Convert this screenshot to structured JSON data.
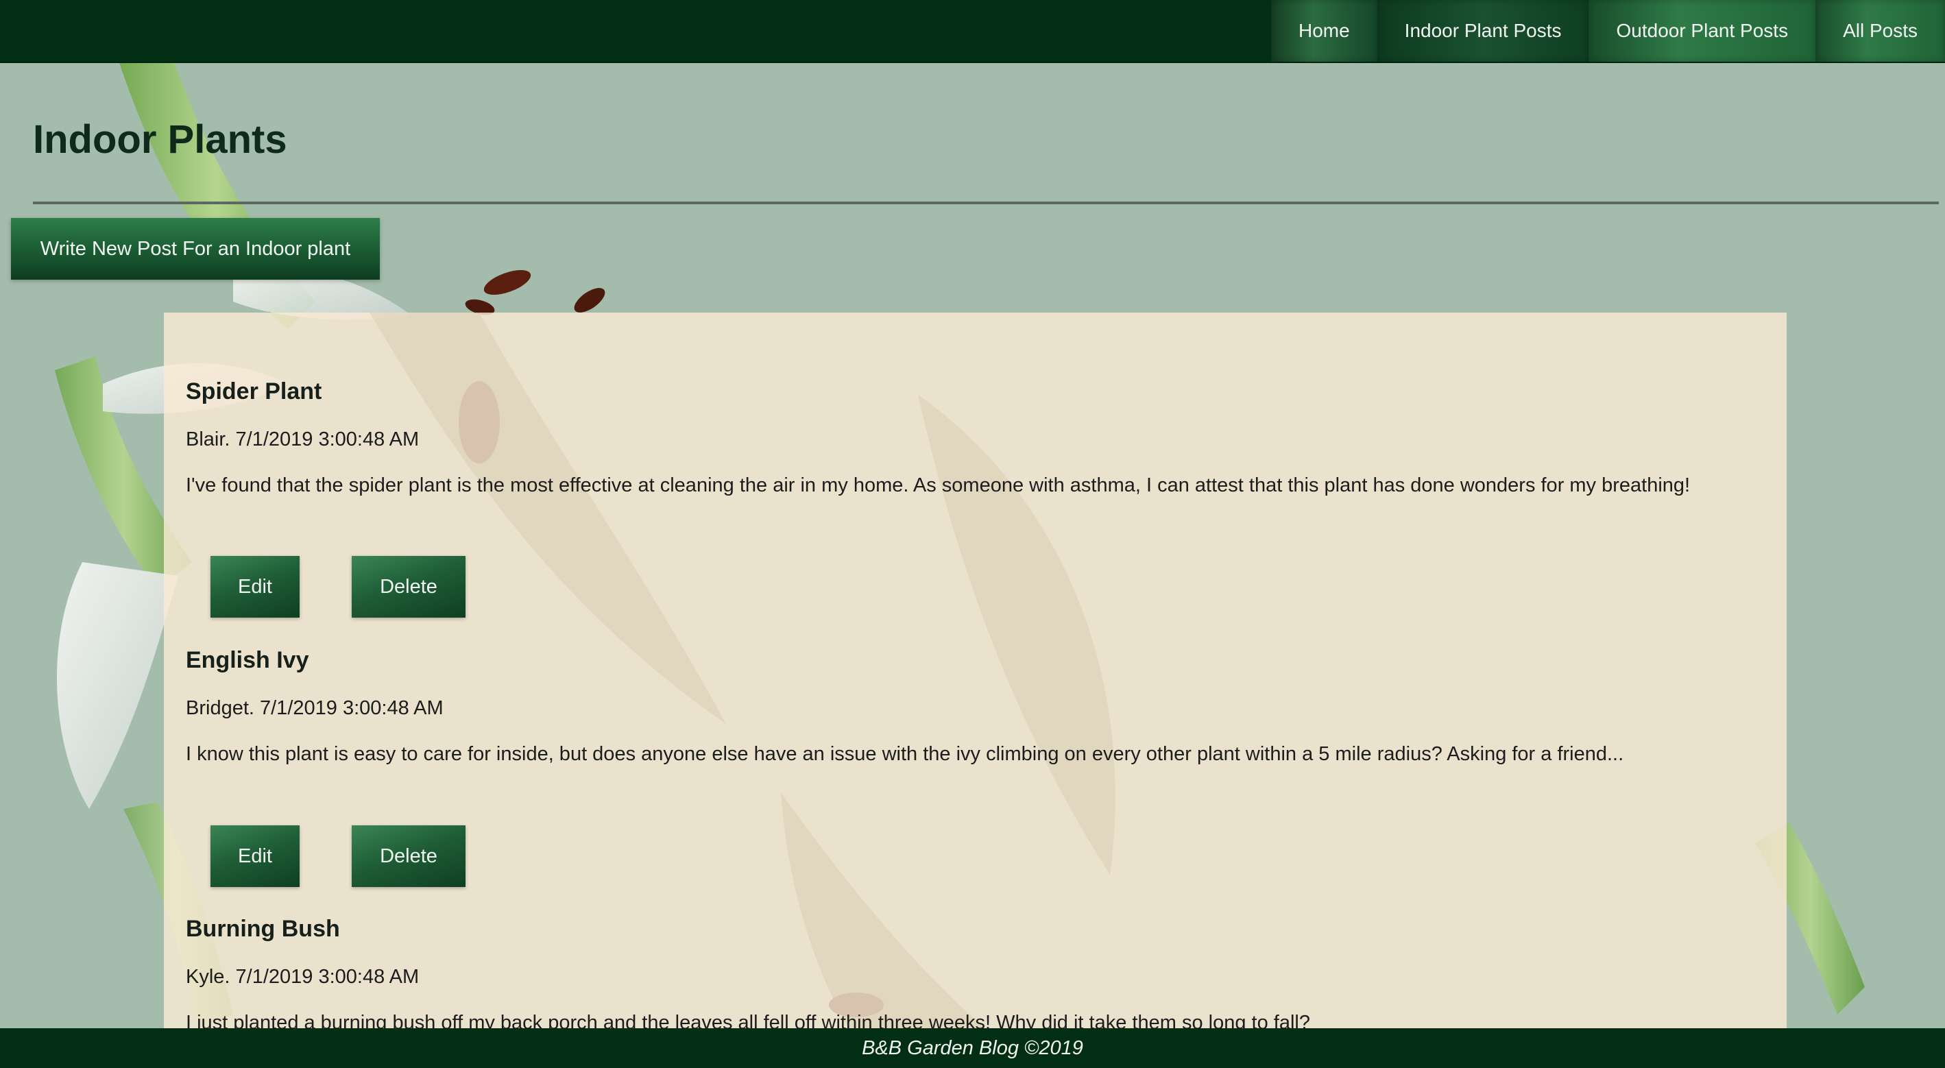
{
  "nav": {
    "items": [
      {
        "label": "Home"
      },
      {
        "label": "Indoor Plant Posts"
      },
      {
        "label": "Outdoor Plant Posts"
      },
      {
        "label": "All Posts"
      }
    ]
  },
  "page": {
    "title": "Indoor Plants",
    "new_post_label": "Write New Post For an Indoor plant"
  },
  "posts": [
    {
      "title": "Spider Plant",
      "meta": "Blair. 7/1/2019 3:00:48 AM",
      "body": "I've found that the spider plant is the most effective at cleaning the air in my home. As someone with asthma, I can attest that this plant has done wonders for my breathing!",
      "edit_label": "Edit",
      "delete_label": "Delete"
    },
    {
      "title": "English Ivy",
      "meta": "Bridget. 7/1/2019 3:00:48 AM",
      "body": "I know this plant is easy to care for inside, but does anyone else have an issue with the ivy climbing on every other plant within a 5 mile radius? Asking for a friend...",
      "edit_label": "Edit",
      "delete_label": "Delete"
    },
    {
      "title": "Burning Bush",
      "meta": "Kyle. 7/1/2019 3:00:48 AM",
      "body": "I just planted a burning bush off my back porch and the leaves all fell off within three weeks! Why did it take them so long to fall?"
    }
  ],
  "footer": {
    "text": "B&B Garden Blog ©2019"
  },
  "colors": {
    "nav_bar": "#022f13",
    "button_green": "#1f5e37",
    "page_background": "#a3bcac",
    "panel_background": "#faead4"
  }
}
